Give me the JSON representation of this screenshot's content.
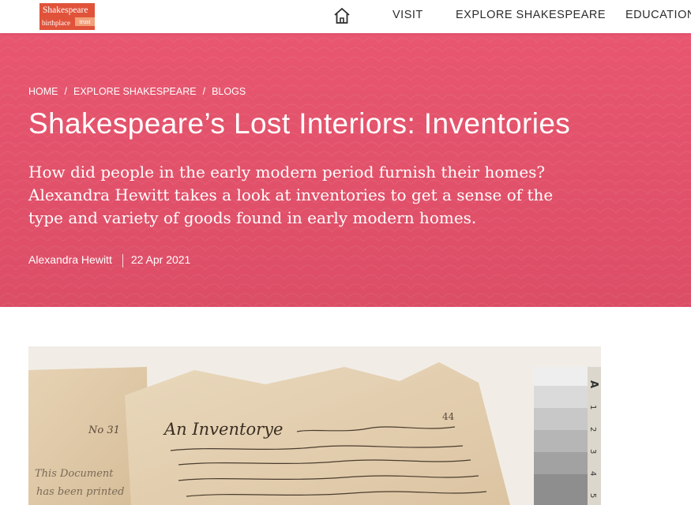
{
  "header": {
    "logo": {
      "line1": "Shakespeare",
      "line2": "birthplace",
      "line3": "trust"
    },
    "nav": {
      "home_icon": "home-icon",
      "visit": "VISIT",
      "explore": "EXPLORE SHAKESPEARE",
      "education": "EDUCATION"
    }
  },
  "hero": {
    "breadcrumb": [
      "HOME",
      "EXPLORE SHAKESPEARE",
      "BLOGS"
    ],
    "breadcrumb_separator": "/",
    "title": "Shakespeare’s Lost Interiors: Inventories",
    "intro": "How did people in the early modern period furnish their homes? Alexandra Hewitt takes a look at inventories to get a sense of the type and variety of goods found in early modern homes.",
    "author": "Alexandra Hewitt",
    "date": "22 Apr 2021",
    "background_color": "#e3516a"
  },
  "document_image": {
    "heading_text": "An Inventorye",
    "catalogue_number": "No 31",
    "page_number": "44",
    "margin_note": [
      "This Document",
      "has been printed"
    ],
    "scale_numbers": [
      "1",
      "2",
      "3",
      "4",
      "5"
    ],
    "scale_letter": "A"
  },
  "colors": {
    "accent": "#e3516a",
    "logo": "#e0533a",
    "nav_text": "#2d2d2d",
    "parchment": "#ddc5a4"
  }
}
